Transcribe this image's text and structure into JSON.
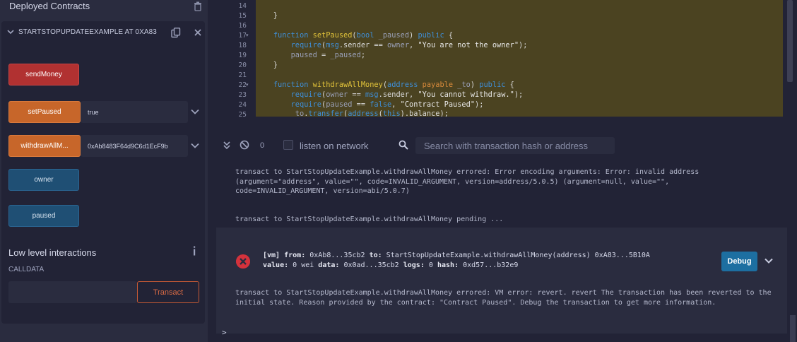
{
  "sidebar": {
    "title": "Deployed Contracts",
    "contract_name": "STARTSTOPUPDATEEXAMPLE AT 0XA83",
    "functions": {
      "send_money": "sendMoney",
      "set_paused": "setPaused",
      "set_paused_value": "true",
      "withdraw_all": "withdrawAllM...",
      "withdraw_value": "0xAb8483F64d9C6d1EcF9b",
      "owner": "owner",
      "paused": "paused"
    },
    "low_level": {
      "title": "Low level interactions",
      "calldata_label": "CALLDATA",
      "transact": "Transact"
    }
  },
  "editor": {
    "line_numbers": [
      "14",
      "15",
      "16",
      "17",
      "18",
      "19",
      "20",
      "21",
      "22",
      "23",
      "24",
      "25"
    ]
  },
  "terminal": {
    "count": "0",
    "listen_label": "listen on network",
    "search_placeholder": "Search with transaction hash or address",
    "log1": "transact to StartStopUpdateExample.withdrawAllMoney errored: Error encoding arguments: Error: invalid address (argument=\"address\", value=\"\", code=INVALID_ARGUMENT, version=address/5.0.5) (argument=null, value=\"\", code=INVALID_ARGUMENT, version=abi/5.0.7)",
    "log2": "transact to StartStopUpdateExample.withdrawAllMoney pending ...",
    "tx": {
      "line1_prefix": "[vm]",
      "from_label": "from:",
      "from": "0xAb8...35cb2",
      "to_label": "to:",
      "to": "StartStopUpdateExample.withdrawAllMoney(address) 0xA83...5B10A",
      "value_label": "value:",
      "value": "0 wei",
      "data_label": "data:",
      "data": "0x0ad...35cb2",
      "logs_label": "logs:",
      "logs": "0",
      "hash_label": "hash:",
      "hash": "0xd57...b32e9",
      "debug": "Debug"
    },
    "error_msg": "transact to StartStopUpdateExample.withdrawAllMoney errored: VM error: revert. revert The transaction has been reverted to the initial state. Reason provided by the contract: \"Contract Paused\". Debug the transaction to get more information.",
    "prompt": ">"
  },
  "colors": {
    "send_button": "#b13131",
    "transact_buttons": "#c7662a",
    "call_buttons": "#1f4f74",
    "debug_button": "#1d6fa1",
    "error": "#d3323c",
    "code_highlight": "#4b4321"
  }
}
